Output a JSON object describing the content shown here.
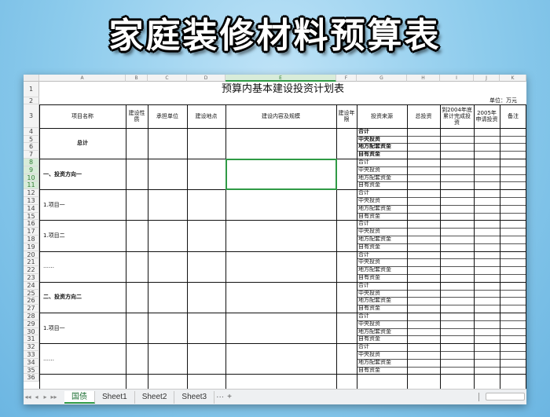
{
  "banner_title": "家庭装修材料预算表",
  "sheet": {
    "columns": [
      "A",
      "B",
      "C",
      "D",
      "E",
      "F",
      "G",
      "H",
      "I",
      "J",
      "K"
    ],
    "selected_column": "E",
    "rows": [
      "1",
      "2",
      "3",
      "4",
      "5",
      "6",
      "7",
      "8",
      "9",
      "10",
      "11",
      "12",
      "13",
      "14",
      "15",
      "16",
      "17",
      "18",
      "19",
      "20",
      "21",
      "22",
      "23",
      "24",
      "25",
      "26",
      "27",
      "28",
      "29",
      "30",
      "31",
      "32",
      "33",
      "34",
      "35",
      "36"
    ],
    "selected_rows": [
      "8",
      "9",
      "10",
      "11"
    ],
    "title": "预算内基本建设投资计划表",
    "unit": "单位：万元",
    "headers": [
      "项目名称",
      "建设性质",
      "承担单位",
      "建设地点",
      "建设内容及规模",
      "建设年限",
      "投资来源",
      "总投资",
      "到2004年底累计完成投资",
      "2005年申请投资",
      "备注"
    ],
    "groups": [
      {
        "label": "总计",
        "bold": true
      },
      {
        "label": "一、投资方向一",
        "bold": true
      },
      {
        "label": "1.项目一",
        "bold": false
      },
      {
        "label": "1.项目二",
        "bold": false
      },
      {
        "label": "……",
        "bold": false
      },
      {
        "label": "二、投资方向二",
        "bold": true
      },
      {
        "label": "1.项目一",
        "bold": false
      },
      {
        "label": "……",
        "bold": false
      }
    ],
    "sources": [
      "合计",
      "中央投资",
      "地方配套资金",
      "自有资金"
    ]
  },
  "tabs": {
    "nav": [
      "◂◂",
      "◂",
      "▸",
      "▸▸"
    ],
    "items": [
      {
        "label": "国债",
        "active": true
      },
      {
        "label": "Sheet1",
        "active": false
      },
      {
        "label": "Sheet2",
        "active": false
      },
      {
        "label": "Sheet3",
        "active": false
      }
    ],
    "more": "···",
    "add": "+"
  }
}
